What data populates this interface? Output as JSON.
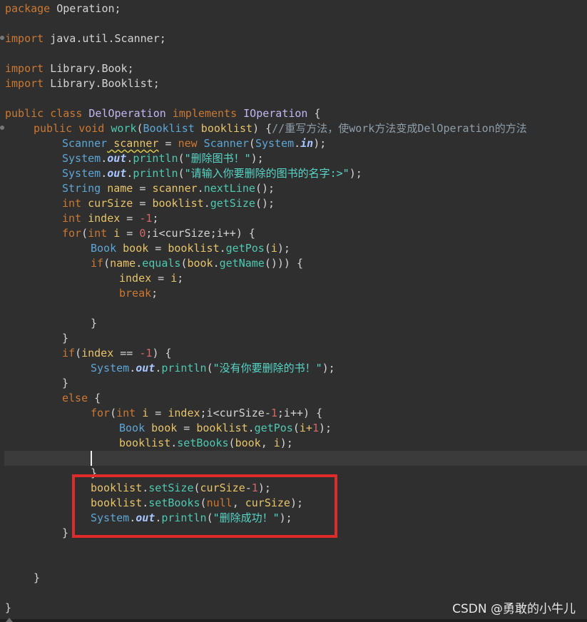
{
  "colors": {
    "background": "#2f2f2f",
    "highlight_box": "#e02b2b",
    "keyword": "#cc7832",
    "string": "#56d6c6",
    "number": "#d06868"
  },
  "code": {
    "l1a": "package",
    "l1b": " Operation;",
    "l2a": "import",
    "l2b": " java.util.Scanner;",
    "l3a": "import",
    "l3b": " Library.Book;",
    "l4a": "import",
    "l4b": " Library.Booklist;",
    "l5a": "public class",
    "l5b": " DelOperation",
    "l5c": " implements",
    "l5d": " IOperation",
    "l5e": " {",
    "l6a": "public void",
    "l6b": " work",
    "l6c": "(",
    "l6d": "Booklist",
    "l6e": " booklist",
    "l6f": ") {",
    "l6g": "//重写方法，使work方法变成DelOperation的方法",
    "l7a": "Scanner",
    "l7b": " scanner",
    "l7c": " = ",
    "l7d": "new",
    "l7e": " Scanner",
    "l7f": "(",
    "l7g": "System",
    "l7h": ".",
    "l7i": "in",
    "l7j": ");",
    "l8a": "System",
    "l8b": ".",
    "l8c": "out",
    "l8d": ".",
    "l8e": "println",
    "l8f": "(",
    "l8g": "\"删除图书！\"",
    "l8h": ");",
    "l9a": "System",
    "l9b": ".",
    "l9c": "out",
    "l9d": ".",
    "l9e": "println",
    "l9f": "(",
    "l9g": "\"请输入你要删除的图书的名字:>\"",
    "l9h": ");",
    "l10a": "String",
    "l10b": " name",
    "l10c": " = ",
    "l10d": "scanner",
    "l10e": ".",
    "l10f": "nextLine",
    "l10g": "();",
    "l11a": "int",
    "l11b": " curSize",
    "l11c": " = ",
    "l11d": "booklist",
    "l11e": ".",
    "l11f": "getSize",
    "l11g": "();",
    "l12a": "int",
    "l12b": " index",
    "l12c": " = ",
    "l12d": "-1",
    "l12e": ";",
    "l13a": "for",
    "l13b": "(",
    "l13c": "int",
    "l13d": " i",
    "l13e": " = ",
    "l13f": "0",
    "l13g": ";i<curSize;i++) {",
    "l14a": "Book",
    "l14b": " book",
    "l14c": " = ",
    "l14d": "booklist",
    "l14e": ".",
    "l14f": "getPos",
    "l14g": "(",
    "l14h": "i",
    "l14i": ");",
    "l15a": "if",
    "l15b": "(",
    "l15c": "name",
    "l15d": ".",
    "l15e": "equals",
    "l15f": "(",
    "l15g": "book",
    "l15h": ".",
    "l15i": "getName",
    "l15j": "())) {",
    "l16a": "index",
    "l16b": " = ",
    "l16c": "i",
    "l16d": ";",
    "l17a": "break",
    "l17b": ";",
    "l18a": "}",
    "l19a": "}",
    "l20a": "if",
    "l20b": "(",
    "l20c": "index",
    "l20d": " == ",
    "l20e": "-1",
    "l20f": ") {",
    "l21a": "System",
    "l21b": ".",
    "l21c": "out",
    "l21d": ".",
    "l21e": "println",
    "l21f": "(",
    "l21g": "\"没有你要删除的书！\"",
    "l21h": ");",
    "l22a": "}",
    "l23a": "else",
    "l23b": " {",
    "l24a": "for",
    "l24b": "(",
    "l24c": "int",
    "l24d": " i",
    "l24e": " = ",
    "l24f": "index",
    "l24g": ";i<curSize-",
    "l24h": "1",
    "l24i": ";i++) {",
    "l25a": "Book",
    "l25b": " book",
    "l25c": " = ",
    "l25d": "booklist",
    "l25e": ".",
    "l25f": "getPos",
    "l25g": "(",
    "l25h": "i+",
    "l25i": "1",
    "l25j": ");",
    "l26a": "booklist",
    "l26b": ".",
    "l26c": "setBooks",
    "l26d": "(",
    "l26e": "book",
    "l26f": ", ",
    "l26g": "i",
    "l26h": ");",
    "l27a": "}",
    "l28a": "booklist",
    "l28b": ".",
    "l28c": "setSize",
    "l28d": "(",
    "l28e": "curSize",
    "l28f": "-",
    "l28g": "1",
    "l28h": ");",
    "l29a": "booklist",
    "l29b": ".",
    "l29c": "setBooks",
    "l29d": "(",
    "l29e": "null",
    "l29f": ", ",
    "l29g": "curSize",
    "l29h": ");",
    "l30a": "System",
    "l30b": ".",
    "l30c": "out",
    "l30d": ".",
    "l30e": "println",
    "l30f": "(",
    "l30g": "\"删除成功！\"",
    "l30h": ");",
    "l31a": "}",
    "l32a": "}",
    "l33a": "}"
  },
  "watermark": "CSDN @勇敢的小牛儿"
}
